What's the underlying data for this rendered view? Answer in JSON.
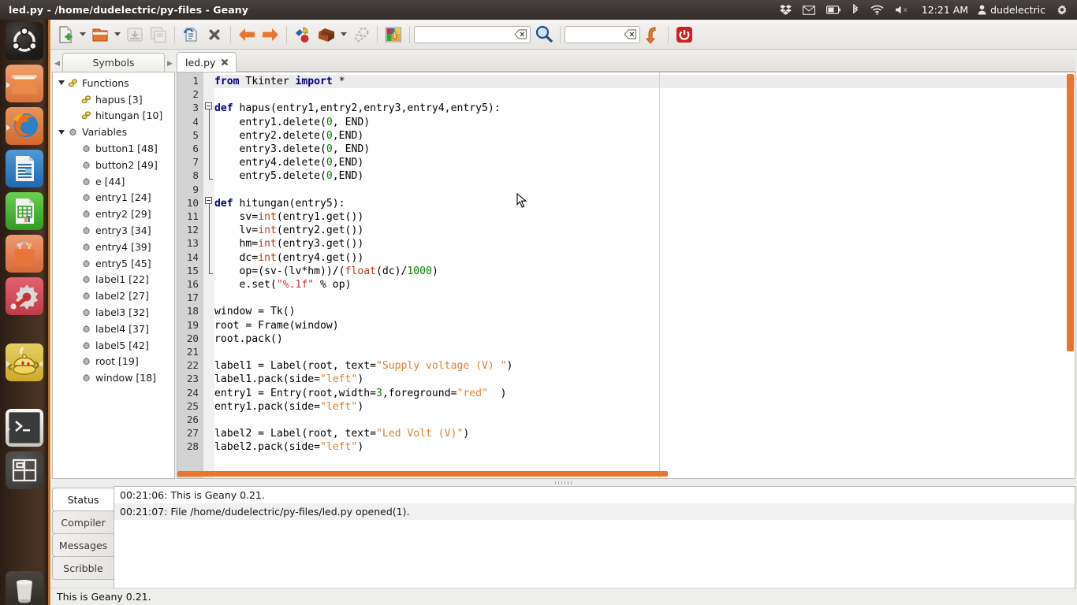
{
  "desktop": {
    "top_panel": {
      "window_title": "led.py - /home/dudelectric/py-files - Geany",
      "tray": [
        {
          "name": "dropbox-icon",
          "label": "Dropbox"
        },
        {
          "name": "mail-icon",
          "label": "Messaging"
        },
        {
          "name": "battery-icon",
          "label": "Battery"
        },
        {
          "name": "bluetooth-icon",
          "label": "Bluetooth"
        },
        {
          "name": "wifi-icon",
          "label": "Network"
        },
        {
          "name": "volume-muted-icon",
          "label": "Sound (muted)"
        }
      ],
      "clock": "12:21 AM",
      "user": "dudelectric",
      "session_icon": "gear-icon"
    },
    "launcher": {
      "items": [
        {
          "name": "ubuntu-dash-icon",
          "label": "Dash Home",
          "running": false
        },
        {
          "name": "files-icon",
          "label": "Files",
          "running": true
        },
        {
          "name": "firefox-icon",
          "label": "Firefox Web Browser",
          "running": true
        },
        {
          "name": "libreoffice-writer-icon",
          "label": "LibreOffice Writer",
          "running": false
        },
        {
          "name": "libreoffice-calc-icon",
          "label": "LibreOffice Calc",
          "running": false
        },
        {
          "name": "software-center-icon",
          "label": "Ubuntu Software Center",
          "running": false
        },
        {
          "name": "system-settings-icon",
          "label": "System Settings",
          "running": false
        },
        {
          "name": "geany-icon",
          "label": "Geany",
          "running": true,
          "focused": true
        },
        {
          "name": "terminal-icon",
          "label": "Terminal",
          "running": true
        },
        {
          "name": "workspace-switcher-icon",
          "label": "Workspace Switcher",
          "running": false
        },
        {
          "name": "trash-icon",
          "label": "Trash",
          "running": false
        }
      ]
    }
  },
  "toolbar": {
    "buttons": [
      {
        "name": "new-file-button",
        "label": "New"
      },
      {
        "name": "new-file-dropdown",
        "label": "New from template"
      },
      {
        "name": "open-file-button",
        "label": "Open"
      },
      {
        "name": "open-file-dropdown",
        "label": "Recent files"
      },
      {
        "name": "save-button",
        "label": "Save",
        "disabled": true
      },
      {
        "name": "save-all-button",
        "label": "Save All",
        "disabled": true
      },
      {
        "name": "reload-button",
        "label": "Reload"
      },
      {
        "name": "close-button",
        "label": "Close"
      },
      {
        "name": "back-button",
        "label": "Navigate back"
      },
      {
        "name": "forward-button",
        "label": "Navigate forward"
      },
      {
        "name": "compile-button",
        "label": "Compile"
      },
      {
        "name": "build-button",
        "label": "Build"
      },
      {
        "name": "build-dropdown",
        "label": "Build options"
      },
      {
        "name": "preferences-button",
        "label": "Preferences",
        "disabled": true
      },
      {
        "name": "color-chooser-button",
        "label": "Color Chooser"
      },
      {
        "name": "quit-button",
        "label": "Quit"
      }
    ],
    "search": {
      "value": "",
      "placeholder": ""
    },
    "goto_line": {
      "value": "",
      "placeholder": ""
    },
    "jump_label": "Jump to the entered line number"
  },
  "sidebar": {
    "tab": "Symbols",
    "prev_arrow": "◀",
    "next_arrow": "▶",
    "tree": [
      {
        "label": "Functions",
        "type": "group",
        "icon": "function-icon",
        "expanded": true
      },
      {
        "label": "hapus [3]",
        "type": "function",
        "icon": "function-icon"
      },
      {
        "label": "hitungan [10]",
        "type": "function",
        "icon": "function-icon"
      },
      {
        "label": "Variables",
        "type": "group",
        "icon": "variable-icon",
        "expanded": true
      },
      {
        "label": "button1 [48]",
        "type": "variable",
        "icon": "variable-icon"
      },
      {
        "label": "button2 [49]",
        "type": "variable",
        "icon": "variable-icon"
      },
      {
        "label": "e [44]",
        "type": "variable",
        "icon": "variable-icon"
      },
      {
        "label": "entry1 [24]",
        "type": "variable",
        "icon": "variable-icon"
      },
      {
        "label": "entry2 [29]",
        "type": "variable",
        "icon": "variable-icon"
      },
      {
        "label": "entry3 [34]",
        "type": "variable",
        "icon": "variable-icon"
      },
      {
        "label": "entry4 [39]",
        "type": "variable",
        "icon": "variable-icon"
      },
      {
        "label": "entry5 [45]",
        "type": "variable",
        "icon": "variable-icon"
      },
      {
        "label": "label1 [22]",
        "type": "variable",
        "icon": "variable-icon"
      },
      {
        "label": "label2 [27]",
        "type": "variable",
        "icon": "variable-icon"
      },
      {
        "label": "label3 [32]",
        "type": "variable",
        "icon": "variable-icon"
      },
      {
        "label": "label4 [37]",
        "type": "variable",
        "icon": "variable-icon"
      },
      {
        "label": "label5 [42]",
        "type": "variable",
        "icon": "variable-icon"
      },
      {
        "label": "root [19]",
        "type": "variable",
        "icon": "variable-icon"
      },
      {
        "label": "window [18]",
        "type": "variable",
        "icon": "variable-icon"
      }
    ]
  },
  "editor": {
    "tab": {
      "label": "led.py",
      "close_icon": "close-icon"
    },
    "first_line": 1,
    "lines": [
      {
        "n": 1,
        "html": "<span class=\"kw\">from</span> Tkinter <span class=\"kw\">import</span> *"
      },
      {
        "n": 2,
        "html": ""
      },
      {
        "n": 3,
        "html": "<span class=\"kw\">def</span> hapus(entry1,entry2,entry3,entry4,entry5):"
      },
      {
        "n": 4,
        "html": "    entry1.delete(<span class=\"num\">0</span>, END)"
      },
      {
        "n": 5,
        "html": "    entry2.delete(<span class=\"num\">0</span>,END)"
      },
      {
        "n": 6,
        "html": "    entry3.delete(<span class=\"num\">0</span>, END)"
      },
      {
        "n": 7,
        "html": "    entry4.delete(<span class=\"num\">0</span>,END)"
      },
      {
        "n": 8,
        "html": "    entry5.delete(<span class=\"num\">0</span>,END)"
      },
      {
        "n": 9,
        "html": ""
      },
      {
        "n": 10,
        "html": "<span class=\"kw\">def</span> hitungan(entry5):"
      },
      {
        "n": 11,
        "html": "    sv=<span class=\"bi\">int</span>(entry1.get())"
      },
      {
        "n": 12,
        "html": "    lv=<span class=\"bi\">int</span>(entry2.get())"
      },
      {
        "n": 13,
        "html": "    hm=<span class=\"bi\">int</span>(entry3.get())"
      },
      {
        "n": 14,
        "html": "    dc=<span class=\"bi\">int</span>(entry4.get())"
      },
      {
        "n": 15,
        "html": "    op=(sv-(lv*hm))/(<span class=\"bi\">float</span>(dc)/<span class=\"num\">1000</span>)"
      },
      {
        "n": 16,
        "html": "    e.set(<span class=\"strr\">\"%.1f\"</span> % op)"
      },
      {
        "n": 17,
        "html": ""
      },
      {
        "n": 18,
        "html": "window = Tk()"
      },
      {
        "n": 19,
        "html": "root = Frame(window)"
      },
      {
        "n": 20,
        "html": "root.pack()"
      },
      {
        "n": 21,
        "html": ""
      },
      {
        "n": 22,
        "html": "label1 = Label(root, text=<span class=\"str\">\"Supply voltage (V) \"</span>)"
      },
      {
        "n": 23,
        "html": "label1.pack(side=<span class=\"str\">\"left\"</span>)"
      },
      {
        "n": 24,
        "html": "entry1 = Entry(root,width=<span class=\"num\">3</span>,foreground=<span class=\"str\">\"red\"</span>  )"
      },
      {
        "n": 25,
        "html": "entry1.pack(side=<span class=\"str\">\"left\"</span>)"
      },
      {
        "n": 26,
        "html": ""
      },
      {
        "n": 27,
        "html": "label2 = Label(root, text=<span class=\"str\">\"Led Volt (V)\"</span>)"
      },
      {
        "n": 28,
        "html": "label2.pack(side=<span class=\"str\">\"left\"</span>)"
      }
    ],
    "source_text": "from Tkinter import *\n\ndef hapus(entry1,entry2,entry3,entry4,entry5):\n    entry1.delete(0, END)\n    entry2.delete(0,END)\n    entry3.delete(0, END)\n    entry4.delete(0,END)\n    entry5.delete(0,END)\n\ndef hitungan(entry5):\n    sv=int(entry1.get())\n    lv=int(entry2.get())\n    hm=int(entry3.get())\n    dc=int(entry4.get())\n    op=(sv-(lv*hm))/(float(dc)/1000)\n    e.set(\"%.1f\" % op)\n\nwindow = Tk()\nroot = Frame(window)\nroot.pack()\n\nlabel1 = Label(root, text=\"Supply voltage (V) \")\nlabel1.pack(side=\"left\")\nentry1 = Entry(root,width=3,foreground=\"red\"  )\nentry1.pack(side=\"left\")\n\nlabel2 = Label(root, text=\"Led Volt (V)\")\nlabel2.pack(side=\"left\")"
  },
  "message_window": {
    "tabs": [
      {
        "label": "Status",
        "active": true
      },
      {
        "label": "Compiler",
        "active": false
      },
      {
        "label": "Messages",
        "active": false
      },
      {
        "label": "Scribble",
        "active": false
      }
    ],
    "status_lines": [
      "00:21:06: This is Geany 0.21.",
      "00:21:07: File /home/dudelectric/py-files/led.py opened(1)."
    ]
  },
  "statusbar": {
    "text": "This is Geany 0.21."
  },
  "colors": {
    "panel_bg": "#3b3634",
    "launcher_accent": "#d98e4a",
    "scrollbar": "#e8762c",
    "keyword": "#00007f",
    "builtin": "#b83c1b",
    "number": "#007f00",
    "string": "#e08030"
  }
}
